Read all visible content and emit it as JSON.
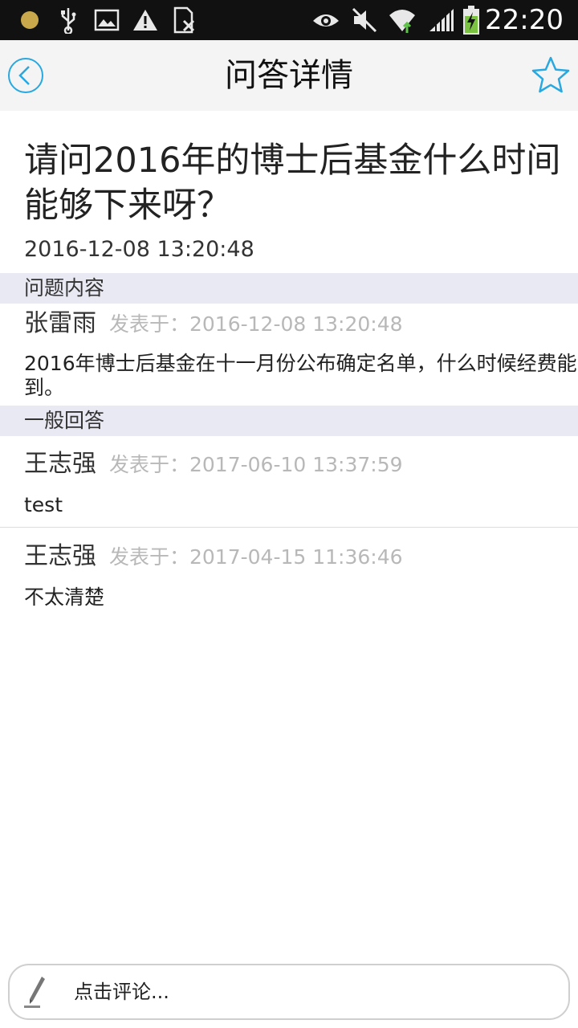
{
  "status_bar": {
    "time": "22:20",
    "icons": [
      "notification-dot-icon",
      "usb-icon",
      "image-icon",
      "warning-icon",
      "sim-icon",
      "eye-icon",
      "mute-icon",
      "wifi-icon",
      "signal-icon",
      "battery-charging-icon"
    ]
  },
  "header": {
    "title": "问答详情",
    "back_icon": "back-icon",
    "favorite_icon": "star-icon"
  },
  "question": {
    "title": "请问2016年的博士后基金什么时间能够下来呀？",
    "date": "2016-12-08 13:20:48"
  },
  "question_section": {
    "label": "问题内容",
    "author": "张雷雨",
    "posted": "发表于：2016-12-08 13:20:48",
    "content": "2016年博士后基金在十一月份公布确定名单，什么时候经费能到。"
  },
  "answers_section": {
    "label": "一般回答",
    "answers": [
      {
        "author": "王志强",
        "posted": "发表于：2017-06-10 13:37:59",
        "content": "test"
      },
      {
        "author": "王志强",
        "posted": "发表于：2017-04-15 11:36:46",
        "content": "不太清楚"
      }
    ]
  },
  "comment": {
    "placeholder": "点击评论...",
    "icon": "pen-icon"
  },
  "colors": {
    "accent": "#29a8e0",
    "section_bg": "#e9e9f3",
    "header_bg": "#f4f4f4",
    "muted_text": "#b8b8b8"
  }
}
